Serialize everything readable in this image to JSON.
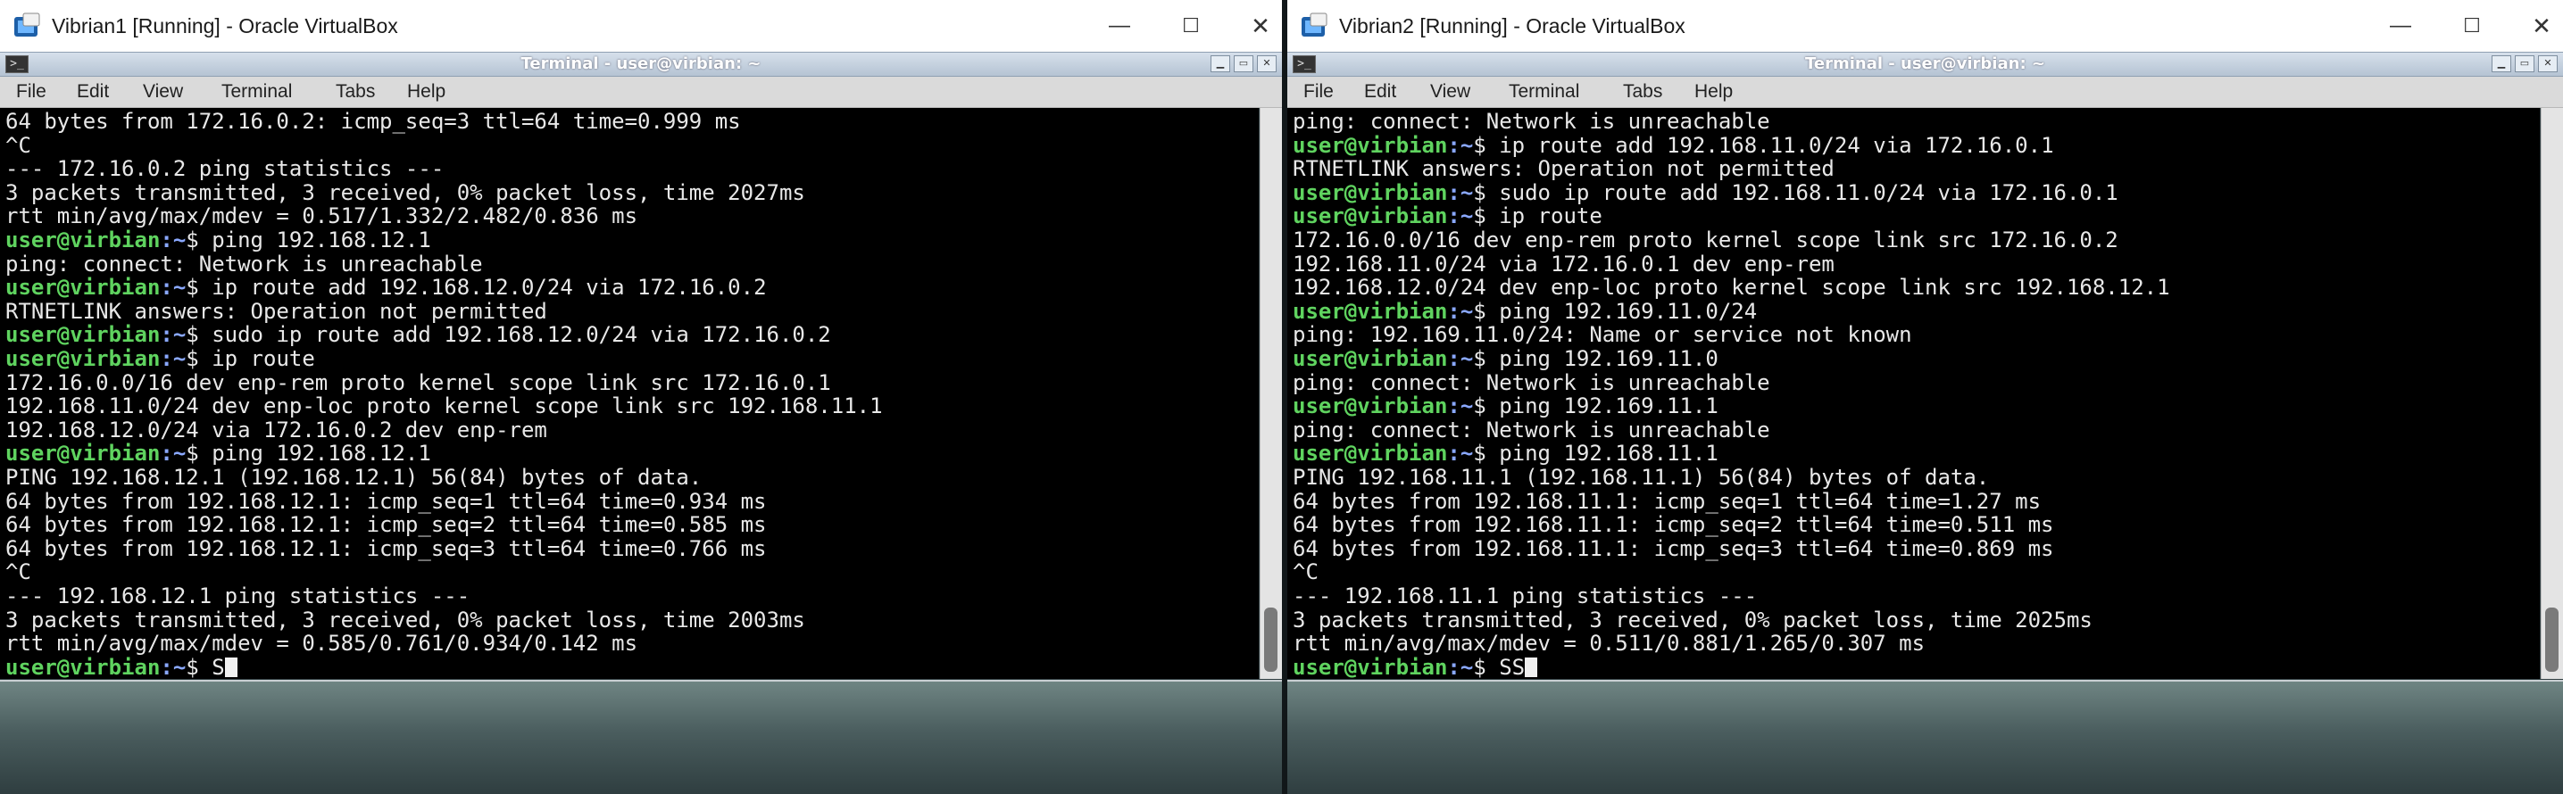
{
  "windows": [
    {
      "title": "Vibrian1 [Running] - Oracle VirtualBox",
      "terminal_title": "Terminal - user@virbian: ~",
      "menu": [
        "File",
        "Edit",
        "View",
        "Terminal",
        "Tabs",
        "Help"
      ],
      "lines": [
        {
          "out": "64 bytes from 172.16.0.2: icmp_seq=3 ttl=64 time=0.999 ms"
        },
        {
          "out": "^C"
        },
        {
          "out": "--- 172.16.0.2 ping statistics ---"
        },
        {
          "out": "3 packets transmitted, 3 received, 0% packet loss, time 2027ms"
        },
        {
          "out": "rtt min/avg/max/mdev = 0.517/1.332/2.482/0.836 ms"
        },
        {
          "user": "user@virbian",
          "path": ":~",
          "cmd": "$ ping 192.168.12.1"
        },
        {
          "out": "ping: connect: Network is unreachable"
        },
        {
          "user": "user@virbian",
          "path": ":~",
          "cmd": "$ ip route add 192.168.12.0/24 via 172.16.0.2"
        },
        {
          "out": "RTNETLINK answers: Operation not permitted"
        },
        {
          "user": "user@virbian",
          "path": ":~",
          "cmd": "$ sudo ip route add 192.168.12.0/24 via 172.16.0.2"
        },
        {
          "user": "user@virbian",
          "path": ":~",
          "cmd": "$ ip route"
        },
        {
          "out": "172.16.0.0/16 dev enp-rem proto kernel scope link src 172.16.0.1"
        },
        {
          "out": "192.168.11.0/24 dev enp-loc proto kernel scope link src 192.168.11.1"
        },
        {
          "out": "192.168.12.0/24 via 172.16.0.2 dev enp-rem"
        },
        {
          "user": "user@virbian",
          "path": ":~",
          "cmd": "$ ping 192.168.12.1"
        },
        {
          "out": "PING 192.168.12.1 (192.168.12.1) 56(84) bytes of data."
        },
        {
          "out": "64 bytes from 192.168.12.1: icmp_seq=1 ttl=64 time=0.934 ms"
        },
        {
          "out": "64 bytes from 192.168.12.1: icmp_seq=2 ttl=64 time=0.585 ms"
        },
        {
          "out": "64 bytes from 192.168.12.1: icmp_seq=3 ttl=64 time=0.766 ms"
        },
        {
          "out": "^C"
        },
        {
          "out": "--- 192.168.12.1 ping statistics ---"
        },
        {
          "out": "3 packets transmitted, 3 received, 0% packet loss, time 2003ms"
        },
        {
          "out": "rtt min/avg/max/mdev = 0.585/0.761/0.934/0.142 ms"
        },
        {
          "user": "user@virbian",
          "path": ":~",
          "cmd": "$ S",
          "cursor": true
        }
      ]
    },
    {
      "title": "Vibrian2 [Running] - Oracle VirtualBox",
      "terminal_title": "Terminal - user@virbian: ~",
      "menu": [
        "File",
        "Edit",
        "View",
        "Terminal",
        "Tabs",
        "Help"
      ],
      "lines": [
        {
          "out": "ping: connect: Network is unreachable"
        },
        {
          "user": "user@virbian",
          "path": ":~",
          "cmd": "$ ip route add 192.168.11.0/24 via 172.16.0.1"
        },
        {
          "out": "RTNETLINK answers: Operation not permitted"
        },
        {
          "user": "user@virbian",
          "path": ":~",
          "cmd": "$ sudo ip route add 192.168.11.0/24 via 172.16.0.1"
        },
        {
          "user": "user@virbian",
          "path": ":~",
          "cmd": "$ ip route"
        },
        {
          "out": "172.16.0.0/16 dev enp-rem proto kernel scope link src 172.16.0.2"
        },
        {
          "out": "192.168.11.0/24 via 172.16.0.1 dev enp-rem"
        },
        {
          "out": "192.168.12.0/24 dev enp-loc proto kernel scope link src 192.168.12.1"
        },
        {
          "user": "user@virbian",
          "path": ":~",
          "cmd": "$ ping 192.169.11.0/24"
        },
        {
          "out": "ping: 192.169.11.0/24: Name or service not known"
        },
        {
          "user": "user@virbian",
          "path": ":~",
          "cmd": "$ ping 192.169.11.0"
        },
        {
          "out": "ping: connect: Network is unreachable"
        },
        {
          "user": "user@virbian",
          "path": ":~",
          "cmd": "$ ping 192.169.11.1"
        },
        {
          "out": "ping: connect: Network is unreachable"
        },
        {
          "user": "user@virbian",
          "path": ":~",
          "cmd": "$ ping 192.168.11.1"
        },
        {
          "out": "PING 192.168.11.1 (192.168.11.1) 56(84) bytes of data."
        },
        {
          "out": "64 bytes from 192.168.11.1: icmp_seq=1 ttl=64 time=1.27 ms"
        },
        {
          "out": "64 bytes from 192.168.11.1: icmp_seq=2 ttl=64 time=0.511 ms"
        },
        {
          "out": "64 bytes from 192.168.11.1: icmp_seq=3 ttl=64 time=0.869 ms"
        },
        {
          "out": "^C"
        },
        {
          "out": "--- 192.168.11.1 ping statistics ---"
        },
        {
          "out": "3 packets transmitted, 3 received, 0% packet loss, time 2025ms"
        },
        {
          "out": "rtt min/avg/max/mdev = 0.511/0.881/1.265/0.307 ms"
        },
        {
          "user": "user@virbian",
          "path": ":~",
          "cmd": "$ SS",
          "cursor": true
        }
      ]
    }
  ],
  "window_controls": {
    "minimize": "—",
    "maximize": "☐",
    "close": "✕"
  },
  "terminal_controls": {
    "minimize": "▁",
    "maximize": "▭",
    "close": "✕"
  },
  "icons": {
    "app": "virtualbox-icon",
    "terminal": "terminal-icon"
  }
}
